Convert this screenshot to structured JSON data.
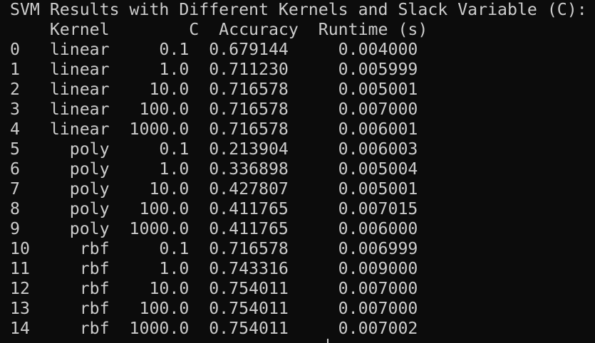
{
  "terminal": {
    "background": "#0c0c0c",
    "foreground": "#cccccc",
    "title_line": "SVM Results with Different Kernels and Slack Variable (C):",
    "header_line": "    Kernel        C  Accuracy  Runtime (s)",
    "rows": [
      "0   linear     0.1  0.679144     0.004000",
      "1   linear     1.0  0.711230     0.005999",
      "2   linear    10.0  0.716578     0.005001",
      "3   linear   100.0  0.716578     0.007000",
      "4   linear  1000.0  0.716578     0.006001",
      "5     poly     0.1  0.213904     0.006003",
      "6     poly     1.0  0.336898     0.005004",
      "7     poly    10.0  0.427807     0.005001",
      "8     poly   100.0  0.411765     0.007015",
      "9     poly  1000.0  0.411765     0.006000",
      "10     rbf     0.1  0.716578     0.006999",
      "11     rbf     1.0  0.743316     0.009000",
      "12     rbf    10.0  0.754011     0.007000",
      "13     rbf   100.0  0.754011     0.007000",
      "14     rbf  1000.0  0.754011     0.007002"
    ]
  }
}
